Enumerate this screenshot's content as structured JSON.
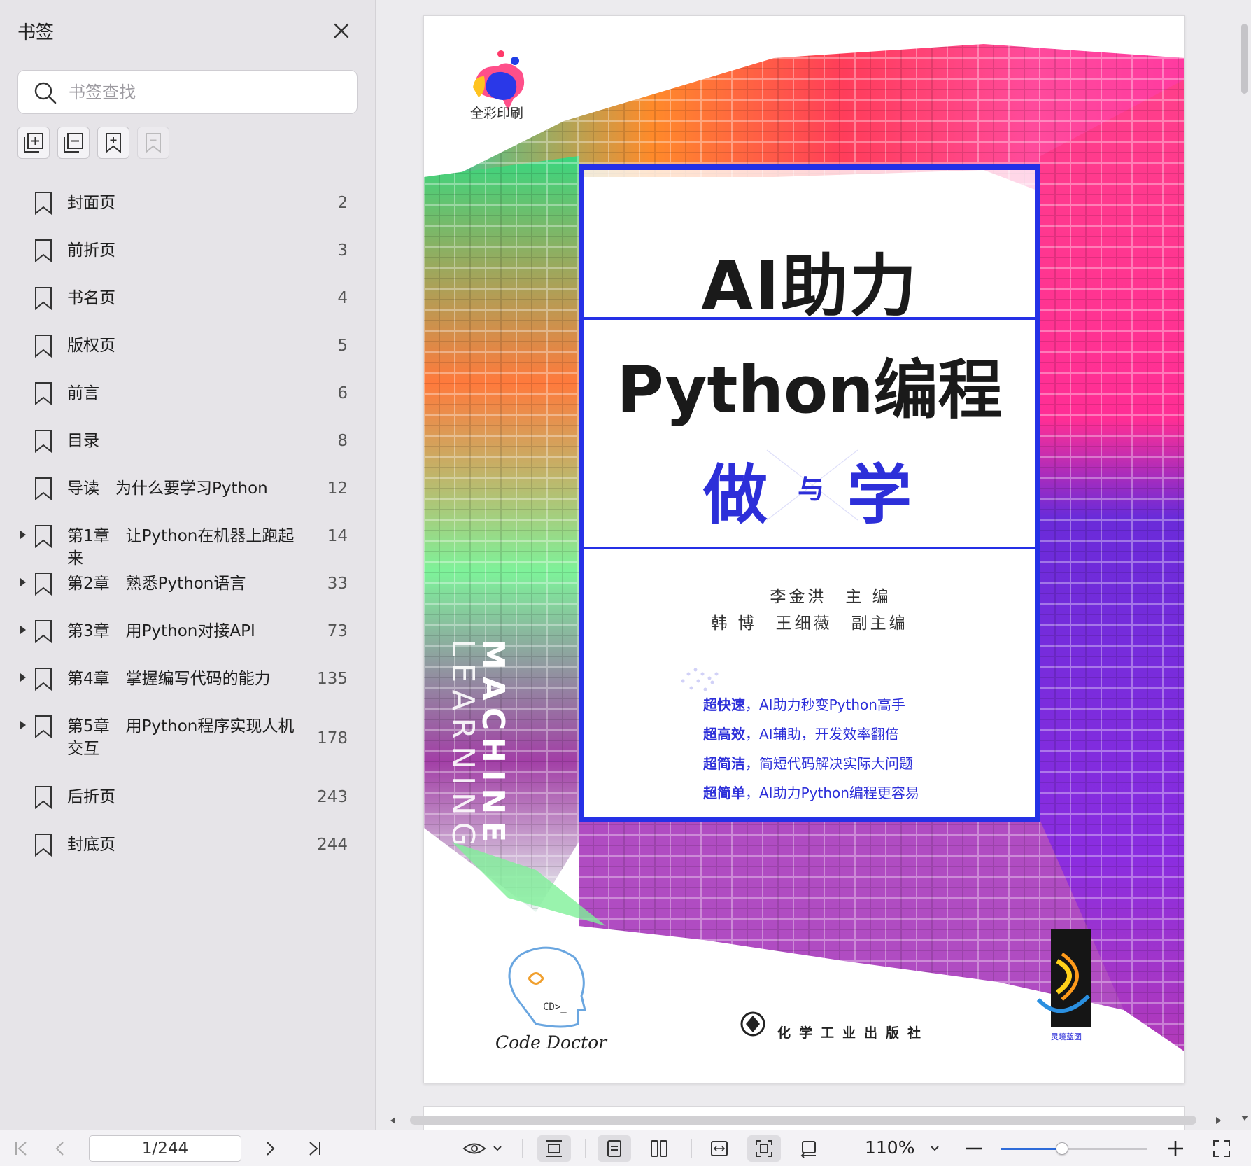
{
  "sidebar": {
    "title": "书签",
    "search_placeholder": "书签查找",
    "bookmarks": [
      {
        "label": "封面页",
        "page": "2",
        "expandable": false
      },
      {
        "label": "前折页",
        "page": "3",
        "expandable": false
      },
      {
        "label": "书名页",
        "page": "4",
        "expandable": false
      },
      {
        "label": "版权页",
        "page": "5",
        "expandable": false
      },
      {
        "label": "前言",
        "page": "6",
        "expandable": false
      },
      {
        "label": "目录",
        "page": "8",
        "expandable": false
      },
      {
        "label": "导读　为什么要学习Python",
        "page": "12",
        "expandable": false
      },
      {
        "label": "第1章　让Python在机器上跑起来",
        "page": "14",
        "expandable": true
      },
      {
        "label": "第2章　熟悉Python语言",
        "page": "33",
        "expandable": true
      },
      {
        "label": "第3章　用Python对接API",
        "page": "73",
        "expandable": true
      },
      {
        "label": "第4章　掌握编写代码的能力",
        "page": "135",
        "expandable": true
      },
      {
        "label": "第5章　用Python程序实现人机交互",
        "page": "178",
        "expandable": true
      },
      {
        "label": "后折页",
        "page": "243",
        "expandable": false
      },
      {
        "label": "封底页",
        "page": "244",
        "expandable": false
      }
    ]
  },
  "cover": {
    "top_label": "全彩印刷",
    "title_line1": "AI助力",
    "title_line2": "Python编程",
    "do": "做",
    "and": "与",
    "learn": "学",
    "editor_line1": "李金洪　主 编",
    "editor_line2": "韩 博　王细薇　副主编",
    "features": [
      {
        "bold": "超快速",
        "text": "，AI助力秒变Python高手"
      },
      {
        "bold": "超高效",
        "text": "，AI辅助，开发效率翻倍"
      },
      {
        "bold": "超简洁",
        "text": "，简短代码解决实际大问题"
      },
      {
        "bold": "超简单",
        "text": "，AI助力Python编程更容易"
      }
    ],
    "vertical_line1": "MACHINE",
    "vertical_line2": "LEARNING",
    "code_doctor": "Code Doctor",
    "publisher": "化学工业出版社",
    "brand": "灵境蓝图",
    "colors": {
      "accent": "#2530e6",
      "title": "#1a1a1a",
      "blue_text": "#2d2fd9"
    }
  },
  "toolbar": {
    "page_indicator": "1/244",
    "zoom": "110%",
    "zoom_slider_fraction": 0.42
  }
}
